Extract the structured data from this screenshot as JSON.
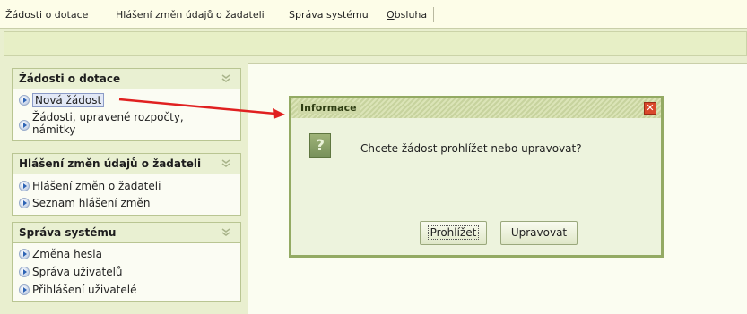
{
  "menubar": {
    "items": [
      {
        "label": "Žádosti o dotace"
      },
      {
        "label": "Hlášení změn údajů o žadateli"
      },
      {
        "label": "Správa systému"
      },
      {
        "label": "Obsluha"
      }
    ]
  },
  "sidebar": {
    "panels": [
      {
        "title": "Žádosti o dotace",
        "items": [
          {
            "label": "Nová žádost"
          },
          {
            "label_line1": "Žádosti, upravené rozpočty,",
            "label_line2": "námitky"
          }
        ]
      },
      {
        "title": "Hlášení změn údajů o žadateli",
        "items": [
          {
            "label": "Hlášení změn o žadateli"
          },
          {
            "label": "Seznam hlášení změn"
          }
        ]
      },
      {
        "title": "Správa systému",
        "items": [
          {
            "label": "Změna hesla"
          },
          {
            "label": "Správa uživatelů"
          },
          {
            "label": "Přihlášení uživatelé"
          }
        ]
      }
    ]
  },
  "dialog": {
    "title": "Informace",
    "message": "Chcete žádost prohlížet nebo upravovat?",
    "buttons": {
      "view": "Prohlížet",
      "edit": "Upravovat"
    }
  },
  "icons": {
    "question": "?",
    "close": "✕"
  },
  "colors": {
    "background": "#e9efcf",
    "accent": "#93aa63",
    "annotation_arrow": "#e02020",
    "close": "#d9482b"
  }
}
